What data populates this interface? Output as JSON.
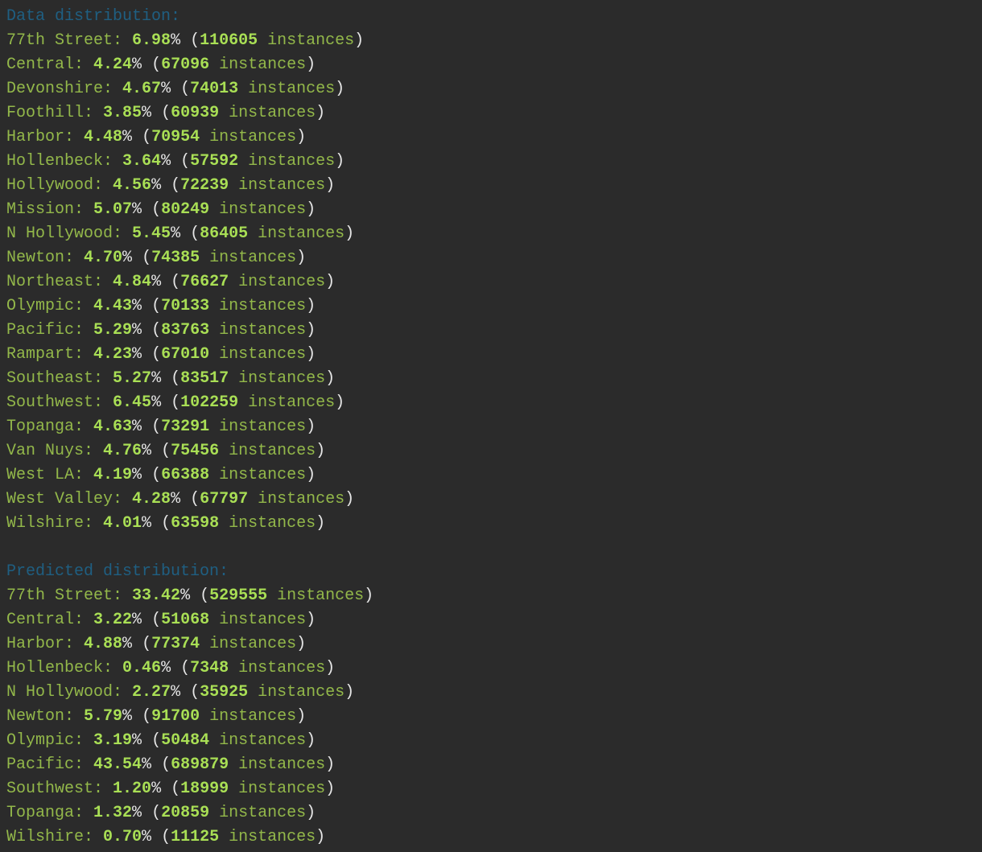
{
  "colors": {
    "background": "#2b2b2b",
    "heading": "#1f5f82",
    "label": "#93b84a",
    "number": "#a9df55",
    "punctuation": "#e6e6e6"
  },
  "sections": [
    {
      "heading": "Data distribution:",
      "rows": [
        {
          "name": "77th Street",
          "percent": "6.98",
          "count": "110605"
        },
        {
          "name": "Central",
          "percent": "4.24",
          "count": "67096"
        },
        {
          "name": "Devonshire",
          "percent": "4.67",
          "count": "74013"
        },
        {
          "name": "Foothill",
          "percent": "3.85",
          "count": "60939"
        },
        {
          "name": "Harbor",
          "percent": "4.48",
          "count": "70954"
        },
        {
          "name": "Hollenbeck",
          "percent": "3.64",
          "count": "57592"
        },
        {
          "name": "Hollywood",
          "percent": "4.56",
          "count": "72239"
        },
        {
          "name": "Mission",
          "percent": "5.07",
          "count": "80249"
        },
        {
          "name": "N Hollywood",
          "percent": "5.45",
          "count": "86405"
        },
        {
          "name": "Newton",
          "percent": "4.70",
          "count": "74385"
        },
        {
          "name": "Northeast",
          "percent": "4.84",
          "count": "76627"
        },
        {
          "name": "Olympic",
          "percent": "4.43",
          "count": "70133"
        },
        {
          "name": "Pacific",
          "percent": "5.29",
          "count": "83763"
        },
        {
          "name": "Rampart",
          "percent": "4.23",
          "count": "67010"
        },
        {
          "name": "Southeast",
          "percent": "5.27",
          "count": "83517"
        },
        {
          "name": "Southwest",
          "percent": "6.45",
          "count": "102259"
        },
        {
          "name": "Topanga",
          "percent": "4.63",
          "count": "73291"
        },
        {
          "name": "Van Nuys",
          "percent": "4.76",
          "count": "75456"
        },
        {
          "name": "West LA",
          "percent": "4.19",
          "count": "66388"
        },
        {
          "name": "West Valley",
          "percent": "4.28",
          "count": "67797"
        },
        {
          "name": "Wilshire",
          "percent": "4.01",
          "count": "63598"
        }
      ]
    },
    {
      "heading": "Predicted distribution:",
      "rows": [
        {
          "name": "77th Street",
          "percent": "33.42",
          "count": "529555"
        },
        {
          "name": "Central",
          "percent": "3.22",
          "count": "51068"
        },
        {
          "name": "Harbor",
          "percent": "4.88",
          "count": "77374"
        },
        {
          "name": "Hollenbeck",
          "percent": "0.46",
          "count": "7348"
        },
        {
          "name": "N Hollywood",
          "percent": "2.27",
          "count": "35925"
        },
        {
          "name": "Newton",
          "percent": "5.79",
          "count": "91700"
        },
        {
          "name": "Olympic",
          "percent": "3.19",
          "count": "50484"
        },
        {
          "name": "Pacific",
          "percent": "43.54",
          "count": "689879"
        },
        {
          "name": "Southwest",
          "percent": "1.20",
          "count": "18999"
        },
        {
          "name": "Topanga",
          "percent": "1.32",
          "count": "20859"
        },
        {
          "name": "Wilshire",
          "percent": "0.70",
          "count": "11125"
        }
      ]
    }
  ],
  "labels": {
    "separator": ": ",
    "percent_sign": "%",
    "open_paren": " (",
    "instances_word": " instances",
    "close_paren": ")"
  }
}
